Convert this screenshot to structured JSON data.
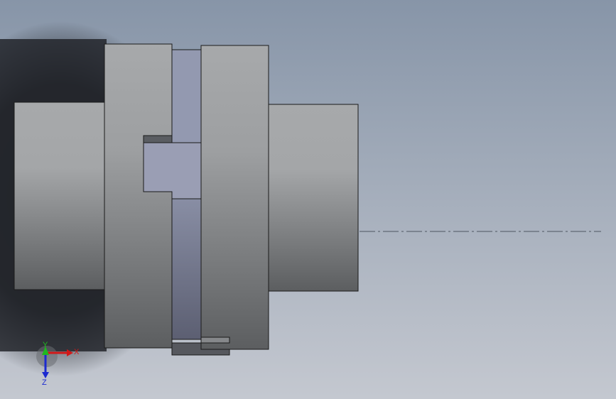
{
  "viewport": {
    "background_top": "#8795a8",
    "background_bottom": "#c4c8d0"
  },
  "model": {
    "metal_light": "#a7a9ab",
    "metal_dark": "#5c5e60",
    "spacer_light": "#9399b0",
    "spacer_dark": "#5c5f72",
    "edge_color": "#1a1a1a"
  },
  "triad": {
    "x_label": "X",
    "y_label": "Y",
    "z_label": "Z",
    "x_color": "#d01818",
    "y_color": "#1fb81f",
    "z_color": "#1c2ad0"
  },
  "centerline": {
    "color": "#4e5560"
  }
}
